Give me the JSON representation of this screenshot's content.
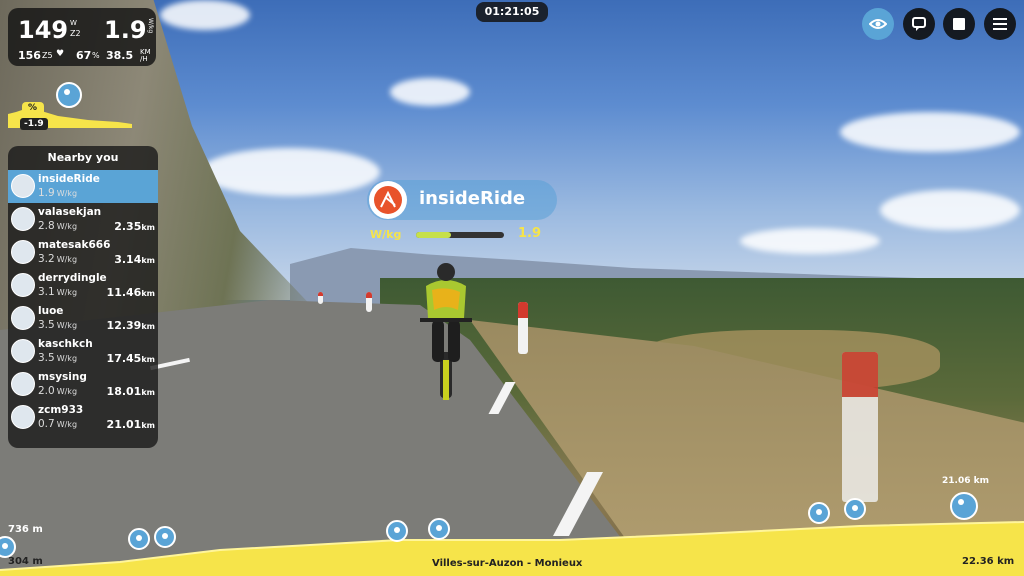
{
  "metrics": {
    "power": "149",
    "power_unit_top": "W",
    "power_zone": "Z2",
    "wkg": "1.9",
    "wkg_unit": "W/kg",
    "heart_rate": "156",
    "hr_zone": "Z5",
    "cadence": "67",
    "cadence_unit": "%",
    "speed": "38.5",
    "speed_unit_top": "KM",
    "speed_unit_bottom": "/H"
  },
  "timer": "01:21:05",
  "gradient": {
    "symbol": "%",
    "value": "-1.9"
  },
  "nearby": {
    "title": "Nearby you",
    "riders": [
      {
        "name": "insideRide",
        "wkg": "1.9",
        "km": "",
        "me": true
      },
      {
        "name": "valasekjan",
        "wkg": "2.8",
        "km": "2.35"
      },
      {
        "name": "matesak666",
        "wkg": "3.2",
        "km": "3.14"
      },
      {
        "name": "derrydingle",
        "wkg": "3.1",
        "km": "11.46"
      },
      {
        "name": "luoe",
        "wkg": "3.5",
        "km": "12.39"
      },
      {
        "name": "kaschkch",
        "wkg": "3.5",
        "km": "17.45"
      },
      {
        "name": "msysing",
        "wkg": "2.0",
        "km": "18.01"
      },
      {
        "name": "zcm933",
        "wkg": "0.7",
        "km": "21.01"
      }
    ],
    "wkg_unit": "W/kg",
    "km_unit": "km"
  },
  "banner": {
    "name": "insideRide",
    "wkg_label": "W/kg",
    "wkg_value": "1.9",
    "wkg_fraction": 0.4
  },
  "elevation": {
    "max": "736 m",
    "min": "304 m",
    "route": "Villes-sur-Auzon - Monieux",
    "total": "22.36 km",
    "position": "21.06 km"
  },
  "colors": {
    "accent": "#5aa4d6",
    "profile": "#f6e44a",
    "banner_logo": "#e8532b"
  }
}
